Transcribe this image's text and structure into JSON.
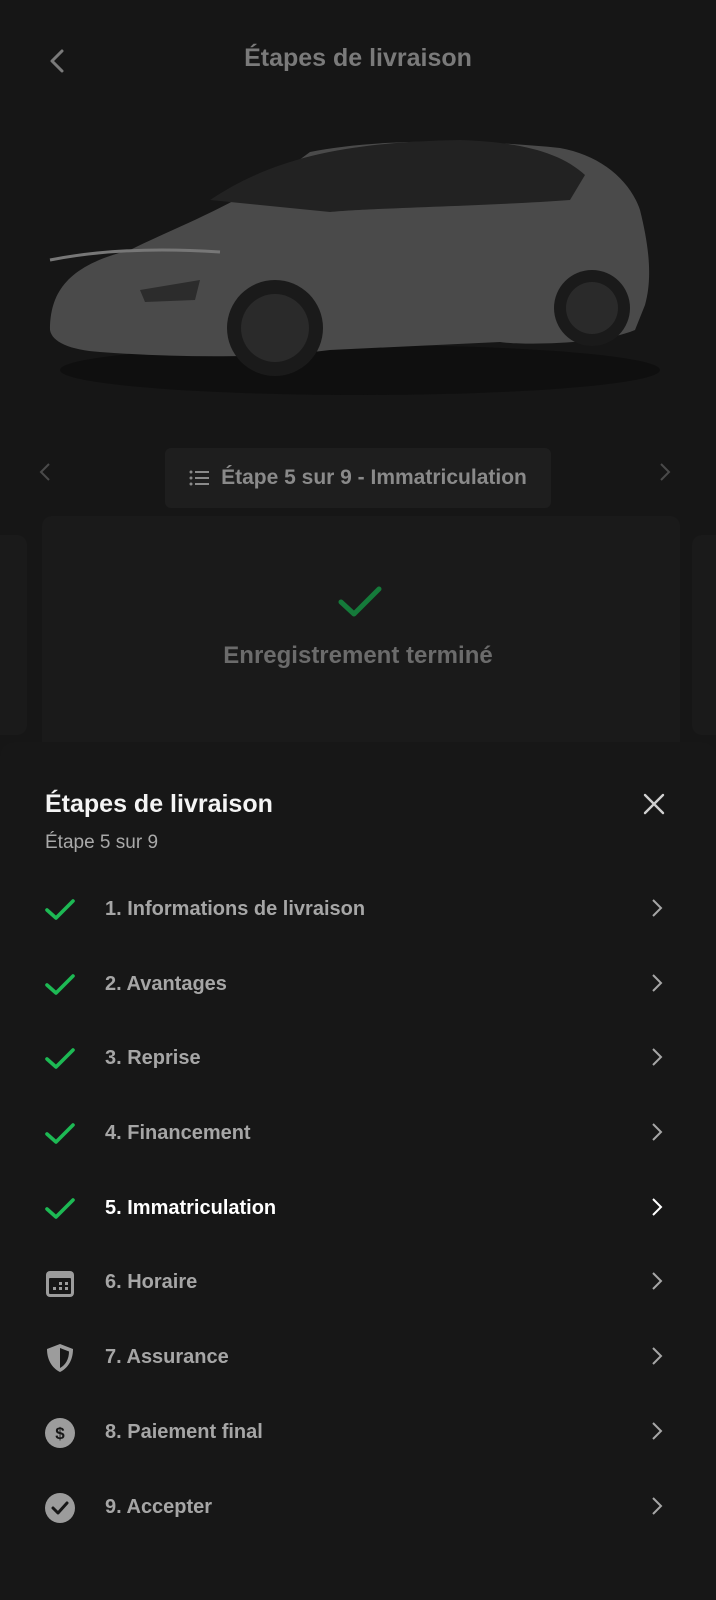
{
  "header": {
    "title": "Étapes de livraison"
  },
  "stepper": {
    "label": "Étape 5 sur 9 - Immatriculation"
  },
  "status_card": {
    "text": "Enregistrement terminé"
  },
  "sheet": {
    "title": "Étapes de livraison",
    "subtitle": "Étape 5 sur 9",
    "steps": [
      {
        "label": "1. Informations de livraison",
        "status": "done"
      },
      {
        "label": "2. Avantages",
        "status": "done"
      },
      {
        "label": "3. Reprise",
        "status": "done"
      },
      {
        "label": "4. Financement",
        "status": "done"
      },
      {
        "label": "5. Immatriculation",
        "status": "done"
      },
      {
        "label": "6. Horaire",
        "status": "calendar-icon"
      },
      {
        "label": "7. Assurance",
        "status": "shield-icon"
      },
      {
        "label": "8. Paiement final",
        "status": "dollar-icon"
      },
      {
        "label": "9. Accepter",
        "status": "check-circle-icon"
      }
    ]
  },
  "colors": {
    "accent_green": "#1db954",
    "background": "#161616"
  }
}
